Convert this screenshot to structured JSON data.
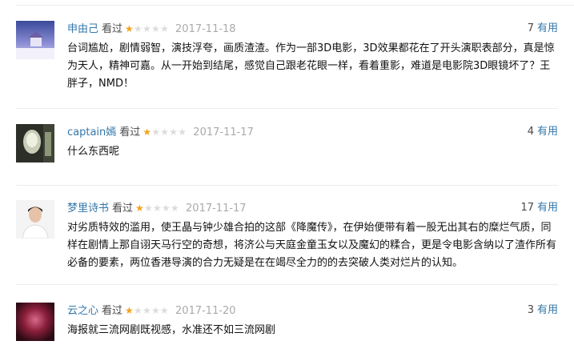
{
  "rating_colors": {
    "on": "#f3a31c",
    "off": "#dcdcdc"
  },
  "reviews": [
    {
      "user": "申由己",
      "watched": "看过",
      "rating": 1,
      "max_rating": 5,
      "date": "2017-11-18",
      "useful_count": "7",
      "useful_label": "有用",
      "content": "台词尴尬，剧情弱智，演技浮夸，画质渣渣。作为一部3D电影，3D效果都花在了开头演职表部分，真是惊为天人，精神可嘉。从一开始到结尾，感觉自己跟老花眼一样，看着重影，难道是电影院3D眼镜坏了？王胖子，NMD！"
    },
    {
      "user": "captain嫣",
      "watched": "看过",
      "rating": 1,
      "max_rating": 5,
      "date": "2017-11-17",
      "useful_count": "4",
      "useful_label": "有用",
      "content": "什么东西呢"
    },
    {
      "user": "梦里诗书",
      "watched": "看过",
      "rating": 1,
      "max_rating": 5,
      "date": "2017-11-17",
      "useful_count": "17",
      "useful_label": "有用",
      "content": "对劣质特效的滥用，使王晶与钟少雄合拍的这部《降魔传》，在伊始便带有着一股无出其右的糜烂气质，同样在剧情上那自诩天马行空的奇想，将济公与天庭金童玉女以及魔幻的糅合，更是令电影含纳以了渣作所有必备的要素，两位香港导演的合力无疑是在在竭尽全力的的去突破人类对烂片的认知。"
    },
    {
      "user": "云之心",
      "watched": "看过",
      "rating": 1,
      "max_rating": 5,
      "date": "2017-11-20",
      "useful_count": "3",
      "useful_label": "有用",
      "content": "海报就三流网剧既视感，水准还不如三流网剧"
    }
  ]
}
